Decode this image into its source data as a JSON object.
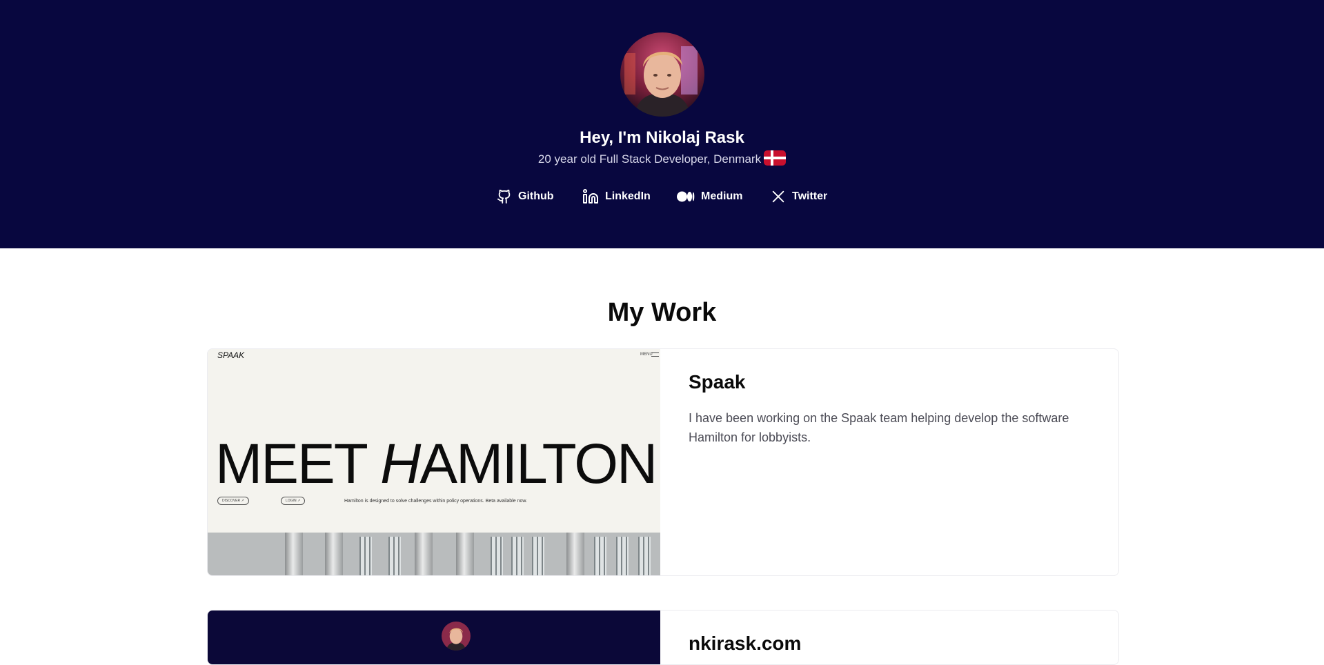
{
  "hero": {
    "title": "Hey, I'm Nikolaj Rask",
    "subtitle": "20 year old Full Stack Developer, Denmark",
    "flag_icon": "denmark-flag-icon",
    "background_color": "#08073f"
  },
  "social_links": [
    {
      "label": "Github",
      "icon": "github-icon"
    },
    {
      "label": "LinkedIn",
      "icon": "linkedin-icon"
    },
    {
      "label": "Medium",
      "icon": "medium-icon"
    },
    {
      "label": "Twitter",
      "icon": "x-twitter-icon"
    }
  ],
  "work": {
    "title": "My Work",
    "projects": [
      {
        "title": "Spaak",
        "description": "I have been working on the Spaak team helping develop the software Hamilton for lobbyists.",
        "preview": {
          "logo": "SPAAK",
          "menu": "MENU",
          "headline_part1": "MEET ",
          "headline_italic": "H",
          "headline_part2": "AMILTON",
          "button1": "DISCOVER ↗",
          "button2": "LOGIN ↗",
          "text": "Hamilton is designed to solve challenges within policy operations. Beta available now."
        }
      },
      {
        "title": "nkirask.com"
      }
    ]
  }
}
